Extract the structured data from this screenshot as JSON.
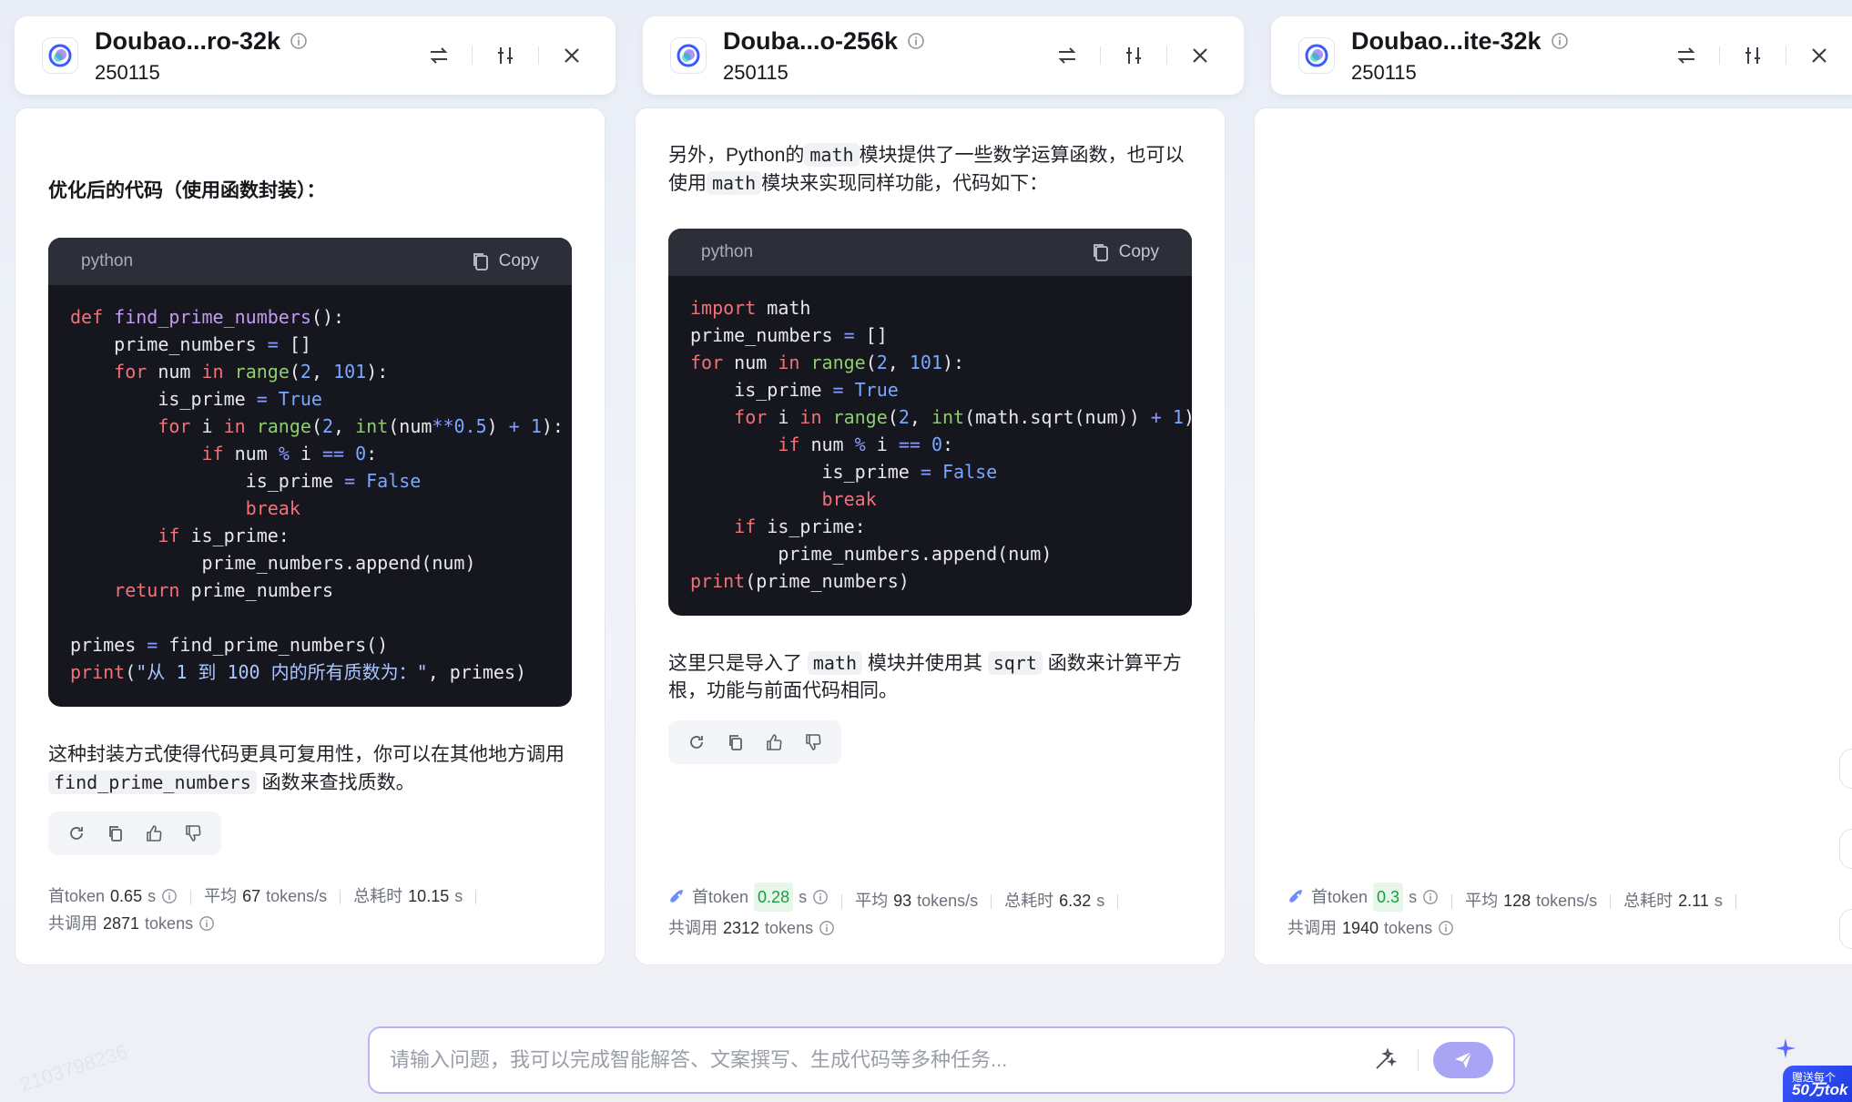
{
  "models": [
    {
      "name": "Doubao...ro-32k",
      "version": "250115"
    },
    {
      "name": "Douba...o-256k",
      "version": "250115"
    },
    {
      "name": "Doubao...ite-32k",
      "version": "250115"
    }
  ],
  "col1": {
    "heading": "优化后的代码（使用函数封装）：",
    "code_lang": "python",
    "copy_label": "Copy",
    "after_text_a": "这种封装方式使得代码更具可复用性，你可以在其他地方调用",
    "after_code": "find_prime_numbers",
    "after_text_b": "函数来查找质数。",
    "stats": {
      "first_token_label": "首token",
      "first_token_value": "0.65",
      "first_token_unit": "s",
      "avg_label": "平均",
      "avg_value": "67",
      "avg_unit": "tokens/s",
      "total_label": "总耗时",
      "total_value": "10.15",
      "total_unit": "s",
      "calls_label": "共调用",
      "calls_value": "2871",
      "calls_unit": "tokens"
    }
  },
  "col2": {
    "intro_a": "另外，Python的",
    "intro_code": "math",
    "intro_b": "模块提供了一些数学运算函数，也可以使用",
    "intro_code2": "math",
    "intro_c": "模块来实现同样功能，代码如下：",
    "code_lang": "python",
    "copy_label": "Copy",
    "after_a": "这里只是导入了",
    "after_code": "math",
    "after_b": "模块并使用其",
    "after_code2": "sqrt",
    "after_c": "函数来计算平方根，功能与前面代码相同。",
    "stats": {
      "first_token_label": "首token",
      "first_token_value": "0.28",
      "first_token_unit": "s",
      "avg_label": "平均",
      "avg_value": "93",
      "avg_unit": "tokens/s",
      "total_label": "总耗时",
      "total_value": "6.32",
      "total_unit": "s",
      "calls_label": "共调用",
      "calls_value": "2312",
      "calls_unit": "tokens"
    }
  },
  "col3": {
    "stats": {
      "first_token_label": "首token",
      "first_token_value": "0.3",
      "first_token_unit": "s",
      "avg_label": "平均",
      "avg_value": "128",
      "avg_unit": "tokens/s",
      "total_label": "总耗时",
      "total_value": "2.11",
      "total_unit": "s",
      "calls_label": "共调用",
      "calls_value": "1940",
      "calls_unit": "tokens"
    }
  },
  "input": {
    "placeholder": "请输入问题，我可以完成智能解答、文案撰写、生成代码等多种任务..."
  },
  "promo": {
    "line1": "赠送每个",
    "line2": "50万tok"
  },
  "watermark_text": "2103798236",
  "colors": {
    "accent": "#a9a4f4",
    "border_accent": "#b9b4f5",
    "code_bg": "#15161e",
    "highlight_green": "#1a9c44"
  }
}
